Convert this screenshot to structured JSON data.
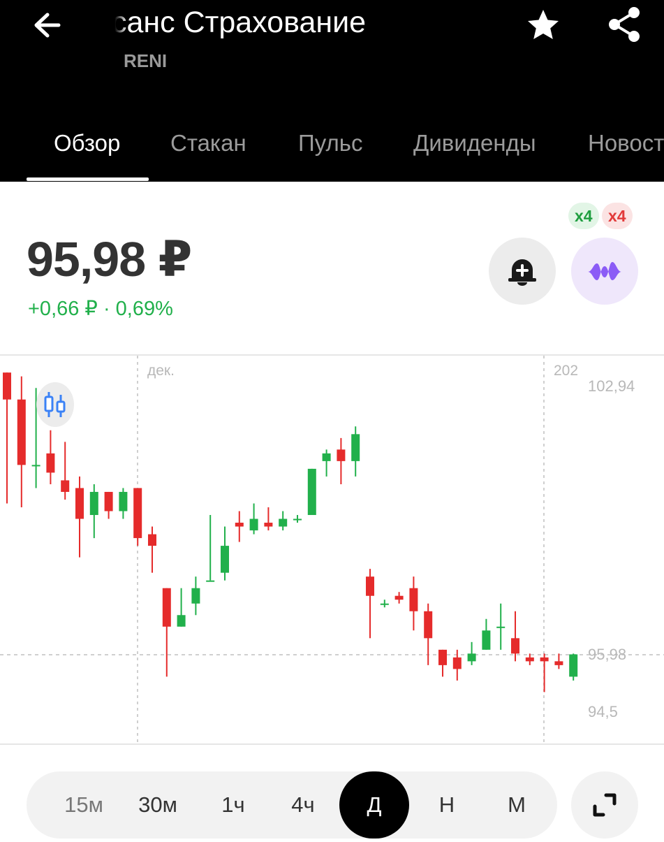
{
  "header": {
    "title": "санс Страхование",
    "ticker": "RENI"
  },
  "tabs": [
    {
      "label": "Обзор",
      "active": true
    },
    {
      "label": "Стакан",
      "active": false
    },
    {
      "label": "Пульс",
      "active": false
    },
    {
      "label": "Дивиденды",
      "active": false
    },
    {
      "label": "Новост",
      "active": false
    }
  ],
  "quote": {
    "price": "95,98 ₽",
    "change": "+0,66 ₽ · 0,69%"
  },
  "badges": {
    "green": "x4",
    "red": "x4"
  },
  "icons": {
    "back": "arrow-left-icon",
    "favorite": "star-icon",
    "share": "share-icon",
    "alert": "bell-plus-icon",
    "ai": "sparkle-wave-icon",
    "candle_mode": "candlestick-icon",
    "expand": "expand-icon"
  },
  "colors": {
    "up": "#21b04b",
    "down": "#e52b2b",
    "accent_purple": "#8b5cf6",
    "candle_mode_blue": "#3b82f6"
  },
  "chart_data": {
    "type": "candlestick",
    "x_labels": [
      "дек.",
      "202"
    ],
    "y_ticks": [
      "102,94",
      "95,98",
      "94,5"
    ],
    "current_price": 95.98,
    "candles": [
      {
        "o": 103.3,
        "h": 103.3,
        "l": 99.9,
        "c": 102.6
      },
      {
        "o": 102.6,
        "h": 103.2,
        "l": 99.8,
        "c": 100.9
      },
      {
        "o": 100.9,
        "h": 102.9,
        "l": 100.3,
        "c": 100.9
      },
      {
        "o": 101.2,
        "h": 101.8,
        "l": 100.4,
        "c": 100.7
      },
      {
        "o": 100.5,
        "h": 101.5,
        "l": 100.0,
        "c": 100.2
      },
      {
        "o": 100.3,
        "h": 100.6,
        "l": 98.5,
        "c": 99.5
      },
      {
        "o": 99.6,
        "h": 100.4,
        "l": 99.0,
        "c": 100.2
      },
      {
        "o": 100.2,
        "h": 100.2,
        "l": 99.5,
        "c": 99.7
      },
      {
        "o": 99.7,
        "h": 100.3,
        "l": 99.5,
        "c": 100.2
      },
      {
        "o": 100.3,
        "h": 100.3,
        "l": 98.8,
        "c": 99.0
      },
      {
        "o": 99.1,
        "h": 99.3,
        "l": 98.1,
        "c": 98.8
      },
      {
        "o": 97.7,
        "h": 97.7,
        "l": 95.4,
        "c": 96.7
      },
      {
        "o": 96.7,
        "h": 97.7,
        "l": 96.7,
        "c": 97.0
      },
      {
        "o": 97.3,
        "h": 98.0,
        "l": 97.0,
        "c": 97.7
      },
      {
        "o": 97.9,
        "h": 99.6,
        "l": 97.9,
        "c": 97.9
      },
      {
        "o": 98.1,
        "h": 99.3,
        "l": 97.9,
        "c": 98.8
      },
      {
        "o": 99.4,
        "h": 99.7,
        "l": 98.9,
        "c": 99.3
      },
      {
        "o": 99.2,
        "h": 99.9,
        "l": 99.1,
        "c": 99.5
      },
      {
        "o": 99.4,
        "h": 99.8,
        "l": 99.2,
        "c": 99.3
      },
      {
        "o": 99.3,
        "h": 99.7,
        "l": 99.2,
        "c": 99.5
      },
      {
        "o": 99.5,
        "h": 99.6,
        "l": 99.4,
        "c": 99.5
      },
      {
        "o": 99.6,
        "h": 100.8,
        "l": 99.6,
        "c": 100.8
      },
      {
        "o": 101.0,
        "h": 101.3,
        "l": 100.6,
        "c": 101.2
      },
      {
        "o": 101.3,
        "h": 101.6,
        "l": 100.4,
        "c": 101.0
      },
      {
        "o": 101.0,
        "h": 101.9,
        "l": 100.6,
        "c": 101.7
      },
      {
        "o": 98.0,
        "h": 98.2,
        "l": 96.4,
        "c": 97.5
      },
      {
        "o": 97.3,
        "h": 97.4,
        "l": 97.2,
        "c": 97.3
      },
      {
        "o": 97.5,
        "h": 97.6,
        "l": 97.3,
        "c": 97.4
      },
      {
        "o": 97.7,
        "h": 98.0,
        "l": 96.6,
        "c": 97.1
      },
      {
        "o": 97.1,
        "h": 97.3,
        "l": 95.7,
        "c": 96.4
      },
      {
        "o": 96.1,
        "h": 96.1,
        "l": 95.4,
        "c": 95.7
      },
      {
        "o": 95.9,
        "h": 96.1,
        "l": 95.3,
        "c": 95.6
      },
      {
        "o": 95.8,
        "h": 96.3,
        "l": 95.7,
        "c": 96.0
      },
      {
        "o": 96.1,
        "h": 96.9,
        "l": 96.1,
        "c": 96.6
      },
      {
        "o": 96.7,
        "h": 97.3,
        "l": 96.1,
        "c": 96.7
      },
      {
        "o": 96.4,
        "h": 97.1,
        "l": 95.8,
        "c": 96.0
      },
      {
        "o": 95.9,
        "h": 96.0,
        "l": 95.7,
        "c": 95.8
      },
      {
        "o": 95.9,
        "h": 96.0,
        "l": 95.0,
        "c": 95.8
      },
      {
        "o": 95.8,
        "h": 96.0,
        "l": 95.6,
        "c": 95.7
      },
      {
        "o": 95.4,
        "h": 96.0,
        "l": 95.3,
        "c": 95.98
      }
    ]
  },
  "timeframes": [
    {
      "label": "15м",
      "active": false
    },
    {
      "label": "30м",
      "active": false
    },
    {
      "label": "1ч",
      "active": false
    },
    {
      "label": "4ч",
      "active": false
    },
    {
      "label": "Д",
      "active": true
    },
    {
      "label": "Н",
      "active": false
    },
    {
      "label": "М",
      "active": false
    }
  ]
}
